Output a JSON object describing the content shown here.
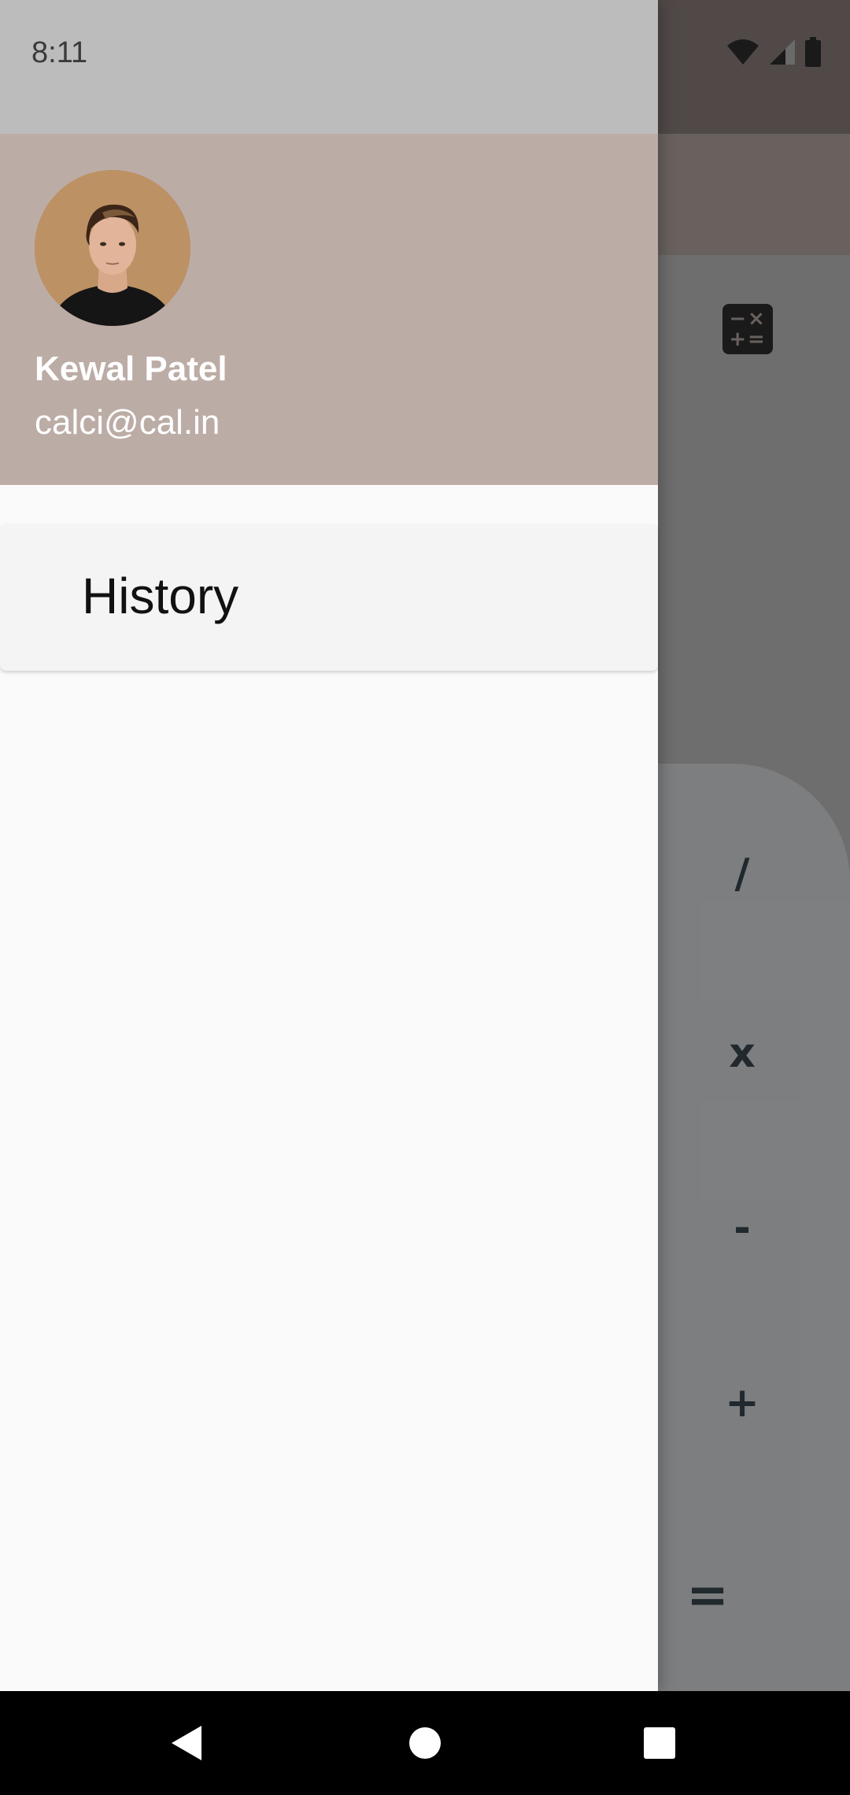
{
  "status_bar": {
    "time": "8:11",
    "icons": [
      "wifi-icon",
      "cell-signal-icon",
      "battery-icon"
    ]
  },
  "drawer": {
    "user_name": "Kewal Patel",
    "user_email": "calci@cal.in",
    "menu_items": [
      {
        "label": "History"
      }
    ]
  },
  "background_app": {
    "toolbar_icon": "calculator-icon",
    "operator_keys": [
      "/",
      "x",
      "-",
      "+",
      "="
    ]
  },
  "nav_bar": {
    "buttons": [
      "back",
      "home",
      "recents"
    ]
  },
  "colors": {
    "drawer_header": "#bcaca6",
    "drawer_background": "#fafafa",
    "operator_text": "#37474f"
  }
}
